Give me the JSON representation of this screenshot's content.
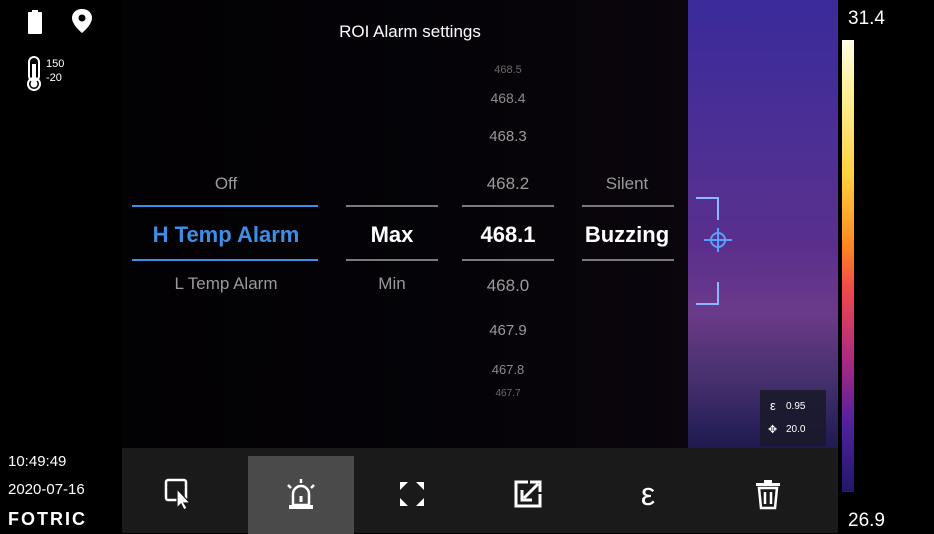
{
  "header": {
    "title": "ROI Alarm settings"
  },
  "status": {
    "range_high": "150",
    "range_low": "-20",
    "time": "10:49:49",
    "date": "2020-07-16",
    "brand": "FOTRIC"
  },
  "picker": {
    "alarm_type": {
      "above": "Off",
      "selected": "H Temp Alarm",
      "below": "L Temp Alarm"
    },
    "measure": {
      "selected": "Max",
      "below": "Min"
    },
    "value": {
      "items": [
        "468.5",
        "468.4",
        "468.3",
        "468.2",
        "468.1",
        "468.0",
        "467.9",
        "467.8",
        "467.7"
      ],
      "selected": "468.1"
    },
    "mode": {
      "above": "Silent",
      "selected": "Buzzing"
    }
  },
  "emissivity": {
    "epsilon": "0.95",
    "distance": "20.0"
  },
  "scale": {
    "max": "31.4",
    "min": "26.9"
  },
  "toolbar": {
    "items": [
      {
        "icon": "roi-select-icon"
      },
      {
        "icon": "alarm-icon",
        "active": true
      },
      {
        "icon": "expand-icon"
      },
      {
        "icon": "export-icon"
      },
      {
        "icon": "epsilon-icon",
        "label": "ε"
      },
      {
        "icon": "trash-icon"
      }
    ]
  },
  "colors": {
    "accent": "#3d8ee5",
    "toolbar_bg": "#1a1a1a",
    "active_tool_bg": "#4a4a4a"
  }
}
